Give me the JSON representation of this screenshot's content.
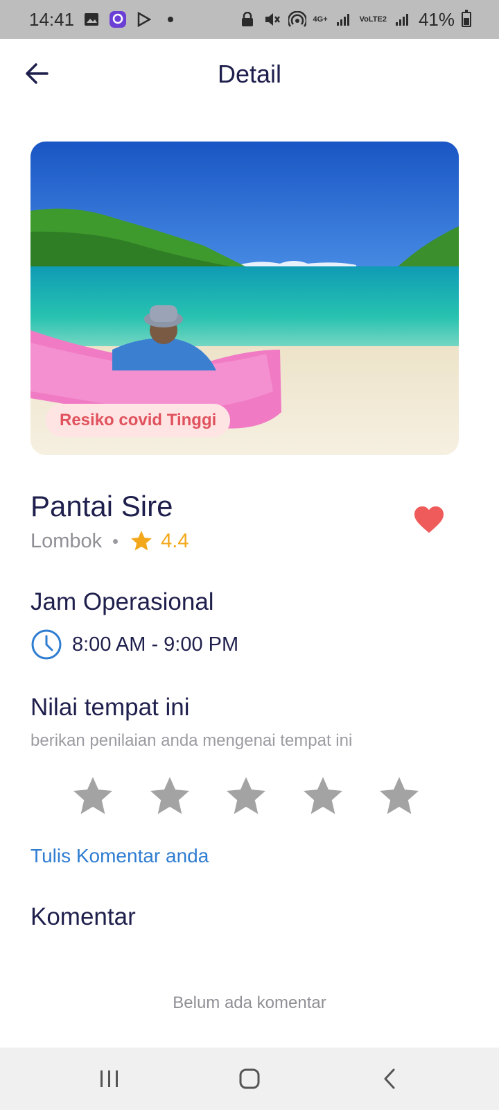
{
  "status_bar": {
    "time": "14:41",
    "network_label": "4G+",
    "volte_label": "VoLTE2",
    "battery": "41%"
  },
  "header": {
    "title": "Detail"
  },
  "hero": {
    "badge": "Resiko covid Tinggi"
  },
  "place": {
    "name": "Pantai Sire",
    "location": "Lombok",
    "rating": "4.4",
    "favorite": true
  },
  "hours": {
    "title": "Jam Operasional",
    "value": "8:00 AM - 9:00 PM"
  },
  "rate": {
    "title": "Nilai tempat ini",
    "subtitle": "berikan penilaian anda mengenai tempat ini",
    "star_count": 5
  },
  "comments": {
    "write_link": "Tulis Komentar anda",
    "title": "Komentar",
    "empty_text": "Belum ada komentar"
  },
  "colors": {
    "primary_text": "#1f1f4d",
    "accent_blue": "#2f7dd1",
    "star_gold": "#f3a81c",
    "heart_red": "#ef5b5b",
    "badge_text": "#e0525d"
  }
}
